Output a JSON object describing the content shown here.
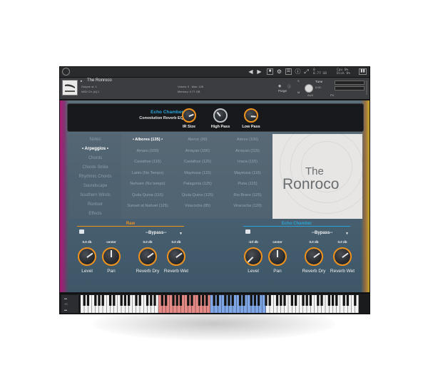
{
  "toolbar": {
    "meters": [
      "0",
      "0.77 GB",
      "Cpu 0%",
      "Disk 0%"
    ],
    "icons": [
      "chevron-left-icon",
      "chevron-right-icon",
      "save-icon",
      "gear-icon",
      "keyboard-icon",
      "info-icon",
      "expand-icon",
      "split-view-icon"
    ]
  },
  "header": {
    "title": "The Ronroco",
    "output_label": "Output: st. 1",
    "midi_label": "MIDI Ch: [A] 1",
    "voices_label": "Voices:",
    "voices_value": "0",
    "max_label": "Max:",
    "max_value": "128",
    "memory_label": "Memory:",
    "memory_value": "0.77 GB",
    "purge_label": "Purge",
    "tune_label": "Tune",
    "tune_value": "0.00",
    "s_label": "S",
    "m_label": "M",
    "aux_label": "AUX",
    "pv_label": "PV"
  },
  "fx_bar": {
    "title": "Echo Chamber",
    "subtitle": "Convolution Reverb EQ",
    "knobs": [
      {
        "label": "IR Size",
        "level": 0.75
      },
      {
        "label": "High Pass",
        "level": 0.35
      },
      {
        "label": "Low Pass",
        "level": 0.85
      }
    ]
  },
  "browser": {
    "categories": [
      {
        "label": "Notes",
        "selected": false
      },
      {
        "label": "• Arpeggios •",
        "selected": true
      },
      {
        "label": "Chords",
        "selected": false
      },
      {
        "label": "Chords Strike",
        "selected": false
      },
      {
        "label": "Rhythmic Chords",
        "selected": false
      },
      {
        "label": "Soundscape",
        "selected": false
      },
      {
        "label": "Southern Winds",
        "selected": false
      },
      {
        "label": "Rontoor",
        "selected": false
      },
      {
        "label": "Effects",
        "selected": false
      }
    ],
    "presets": [
      [
        {
          "label": "• Albores (135) •",
          "selected": true
        },
        {
          "label": "Alerce (90)"
        },
        {
          "label": "Alerce (100)"
        }
      ],
      [
        {
          "label": "Amaru (100)"
        },
        {
          "label": "Arrayan (100)"
        },
        {
          "label": "Arrayan (115)"
        }
      ],
      [
        {
          "label": "Caviahue (115)"
        },
        {
          "label": "Caviahue (125)"
        },
        {
          "label": "Inaca (115)"
        }
      ],
      [
        {
          "label": "Lanin (No Tempo)"
        },
        {
          "label": "Maymara (115)"
        },
        {
          "label": "Maymara (115)"
        }
      ],
      [
        {
          "label": "Nehuen (No tempo)"
        },
        {
          "label": "Patagonia (125)"
        },
        {
          "label": "Puna (115)"
        }
      ],
      [
        {
          "label": "Quila Quina (115)"
        },
        {
          "label": "Quila Quina (125)"
        },
        {
          "label": "Rio Bravo (125)"
        }
      ],
      [
        {
          "label": "Sunset at Nahuel (125)"
        },
        {
          "label": "Viracocha (85)"
        },
        {
          "label": "Viracocha (120)"
        }
      ]
    ]
  },
  "logo": {
    "the": "The",
    "name": "Ronroco"
  },
  "mixer": {
    "raw": {
      "title": "Raw",
      "bypass": "--Bypass--",
      "knobs": [
        {
          "label": "Level",
          "value": "0.0 db",
          "level": 0.7
        },
        {
          "label": "Pan",
          "value": "center",
          "level": 0.5
        },
        {
          "label": "Reverb Dry",
          "value": "0.0 db",
          "level": 0.7
        },
        {
          "label": "Reverb Wet",
          "value": "0.0 db",
          "level": 0.7
        }
      ]
    },
    "echo": {
      "title": "Echo Chamber",
      "bypass": "--Bypass--",
      "knobs": [
        {
          "label": "Level",
          "value": "-inf db",
          "level": 0.0
        },
        {
          "label": "Pan",
          "value": "center",
          "level": 0.5
        },
        {
          "label": "Reverb Dry",
          "value": "0.0 db",
          "level": 0.7
        },
        {
          "label": "Reverb Wet",
          "value": "0.0 db",
          "level": 0.7
        }
      ]
    }
  },
  "colors": {
    "accent_orange": "#f0921e",
    "accent_blue": "#2aa4d8",
    "key_red": "#e58a86",
    "key_blue": "#7fa6e6"
  },
  "keyboard": {
    "octave_label": "+0"
  }
}
